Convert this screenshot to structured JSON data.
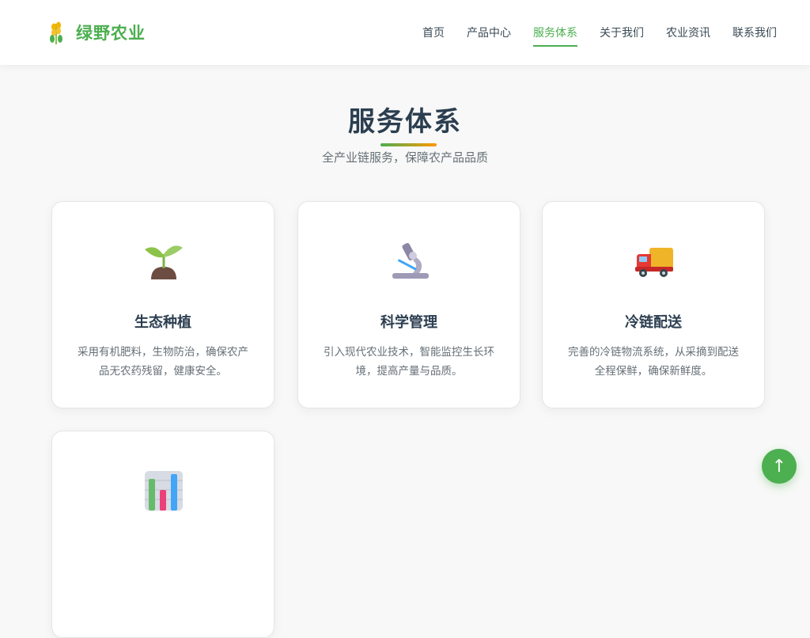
{
  "brand": {
    "name": "绿野农业",
    "icon": "wheat-icon"
  },
  "nav": {
    "items": [
      {
        "label": "首页",
        "active": false
      },
      {
        "label": "产品中心",
        "active": false
      },
      {
        "label": "服务体系",
        "active": true
      },
      {
        "label": "关于我们",
        "active": false
      },
      {
        "label": "农业资讯",
        "active": false
      },
      {
        "label": "联系我们",
        "active": false
      }
    ]
  },
  "section": {
    "title": "服务体系",
    "subtitle": "全产业链服务，保障农产品品质"
  },
  "cards": [
    {
      "icon": "seedling-icon",
      "title": "生态种植",
      "desc": "采用有机肥料，生物防治，确保农产品无农药残留，健康安全。"
    },
    {
      "icon": "microscope-icon",
      "title": "科学管理",
      "desc": "引入现代农业技术，智能监控生长环境，提高产量与品质。"
    },
    {
      "icon": "truck-icon",
      "title": "冷链配送",
      "desc": "完善的冷链物流系统，从采摘到配送全程保鲜，确保新鲜度。"
    },
    {
      "icon": "bar-chart-icon",
      "title": "",
      "desc": ""
    }
  ],
  "back_to_top": {
    "label": "↑",
    "icon": "arrow-up-icon"
  },
  "colors": {
    "accent": "#4caf50",
    "accent2": "#ff9800",
    "text": "#2c3e50"
  }
}
